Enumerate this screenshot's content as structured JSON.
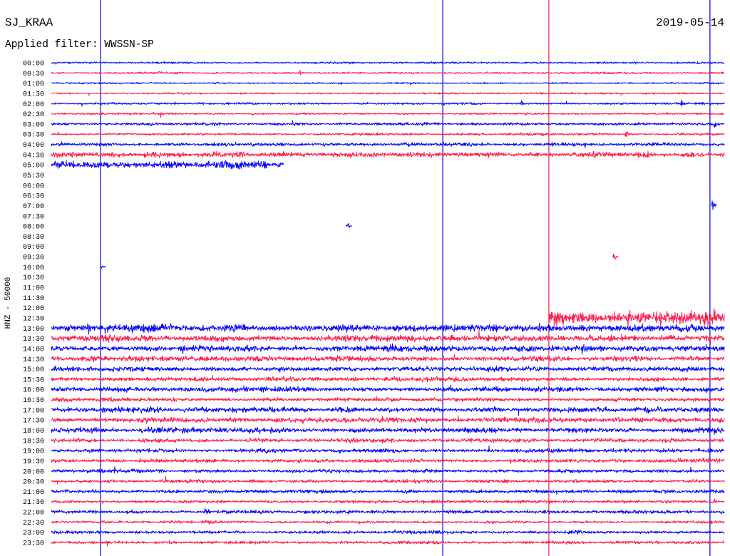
{
  "chart_data": {
    "type": "line",
    "station": "SJ_KRAA",
    "date": "2019-05-14",
    "filter_label": "Applied filter: WWSSN-SP",
    "ylabel": "HNZ - 50000",
    "xlabel": "",
    "grid": false,
    "legend": "none",
    "rows": [
      "00:00",
      "00:30",
      "01:00",
      "01:30",
      "02:00",
      "02:30",
      "03:00",
      "03:30",
      "04:00",
      "04:30",
      "05:00",
      "05:30",
      "06:00",
      "06:30",
      "07:00",
      "07:30",
      "08:00",
      "08:30",
      "09:00",
      "09:30",
      "10:00",
      "10:30",
      "11:00",
      "11:30",
      "12:00",
      "12:30",
      "13:00",
      "13:30",
      "14:00",
      "14:30",
      "15:00",
      "15:30",
      "16:00",
      "16:30",
      "17:00",
      "17:30",
      "18:00",
      "18:30",
      "19:00",
      "19:30",
      "20:00",
      "20:30",
      "21:00",
      "21:30",
      "22:00",
      "22:30",
      "23:00",
      "23:30"
    ],
    "colors": [
      "#0a0aff",
      "#ff1f4f"
    ],
    "gap": {
      "start": "05:10:22",
      "end": "12:52:11"
    },
    "markers": [
      {
        "minute": 2.2,
        "color": "#0000e0"
      },
      {
        "minute": 17.45,
        "color": "#0000e0"
      },
      {
        "minute": 22.18,
        "color": "#f0204e"
      },
      {
        "minute": 29.36,
        "color": "#0000e0"
      }
    ],
    "noise_amplitude": [
      6000,
      6000,
      5000,
      5000,
      6000,
      5500,
      8500,
      7000,
      10500,
      15500,
      24500,
      5000,
      5000,
      5000,
      5000,
      5000,
      5000,
      5000,
      5000,
      5000,
      5000,
      5000,
      5000,
      5000,
      5000,
      38000,
      22500,
      19000,
      17500,
      15500,
      15500,
      14000,
      15500,
      12000,
      15500,
      15500,
      15500,
      12000,
      12000,
      12000,
      10500,
      9800,
      11000,
      8800,
      9800,
      8000,
      9800,
      9800
    ],
    "events": [
      {
        "time": "00:00:10",
        "amplitude": 17000
      },
      {
        "time": "00:26:00",
        "amplitude": 14000
      },
      {
        "time": "00:34:46",
        "amplitude": 21000
      },
      {
        "time": "00:41:04",
        "amplitude": 25000
      },
      {
        "time": "01:33:07",
        "amplitude": 17000
      },
      {
        "time": "02:20:55",
        "amplitude": 32000
      },
      {
        "time": "02:28:04",
        "amplitude": 39000
      },
      {
        "time": "02:34:52",
        "amplitude": 25000
      },
      {
        "time": "02:51:10",
        "amplitude": 32000
      },
      {
        "time": "03:10:44",
        "amplitude": 25000
      },
      {
        "time": "03:14:30",
        "amplitude": 25000
      },
      {
        "time": "03:29:33",
        "amplitude": 28000
      },
      {
        "time": "03:44:30",
        "amplitude": 18000
      },
      {
        "time": "03:55:35",
        "amplitude": 42000
      },
      {
        "time": "04:08:41",
        "amplitude": 28000
      },
      {
        "time": "04:12:10",
        "amplitude": 32000
      },
      {
        "time": "04:54:05",
        "amplitude": 32000
      },
      {
        "time": "05:09:28",
        "amplitude": 42000
      },
      {
        "time": "07:29:26",
        "amplitude": 77000
      },
      {
        "time": "08:13:10",
        "amplitude": 42000
      },
      {
        "time": "09:55:03",
        "amplitude": 49000
      },
      {
        "time": "10:02:12",
        "amplitude": 35000
      },
      {
        "time": "12:55:41",
        "amplitude": 60000
      },
      {
        "time": "12:57:45",
        "amplitude": 50000
      },
      {
        "time": "12:59:30",
        "amplitude": 50000
      },
      {
        "time": "13:01:37",
        "amplitude": 70000
      },
      {
        "time": "13:08:08",
        "amplitude": 35000
      },
      {
        "time": "13:17:59",
        "amplitude": 35000
      },
      {
        "time": "13:27:50",
        "amplitude": 32000
      },
      {
        "time": "13:44:14",
        "amplitude": 28000
      },
      {
        "time": "14:04:42",
        "amplitude": 28000
      },
      {
        "time": "14:25:41",
        "amplitude": 35000
      },
      {
        "time": "14:37:34",
        "amplitude": 28000
      },
      {
        "time": "15:37:34",
        "amplitude": 25000
      },
      {
        "time": "16:03:45",
        "amplitude": 21000
      },
      {
        "time": "16:29:10",
        "amplitude": 28000
      },
      {
        "time": "17:00:44",
        "amplitude": 25000
      },
      {
        "time": "17:09:57",
        "amplitude": 28000
      },
      {
        "time": "17:27:01",
        "amplitude": 32000
      },
      {
        "time": "18:22:59",
        "amplitude": 25000
      },
      {
        "time": "18:29:33",
        "amplitude": 32000
      },
      {
        "time": "19:28:51",
        "amplitude": 28000
      },
      {
        "time": "20:02:48",
        "amplitude": 28000
      },
      {
        "time": "21:28:38",
        "amplitude": 32000
      },
      {
        "time": "22:06:50",
        "amplitude": 25000
      },
      {
        "time": "23:52:55",
        "amplitude": 25000
      }
    ]
  }
}
